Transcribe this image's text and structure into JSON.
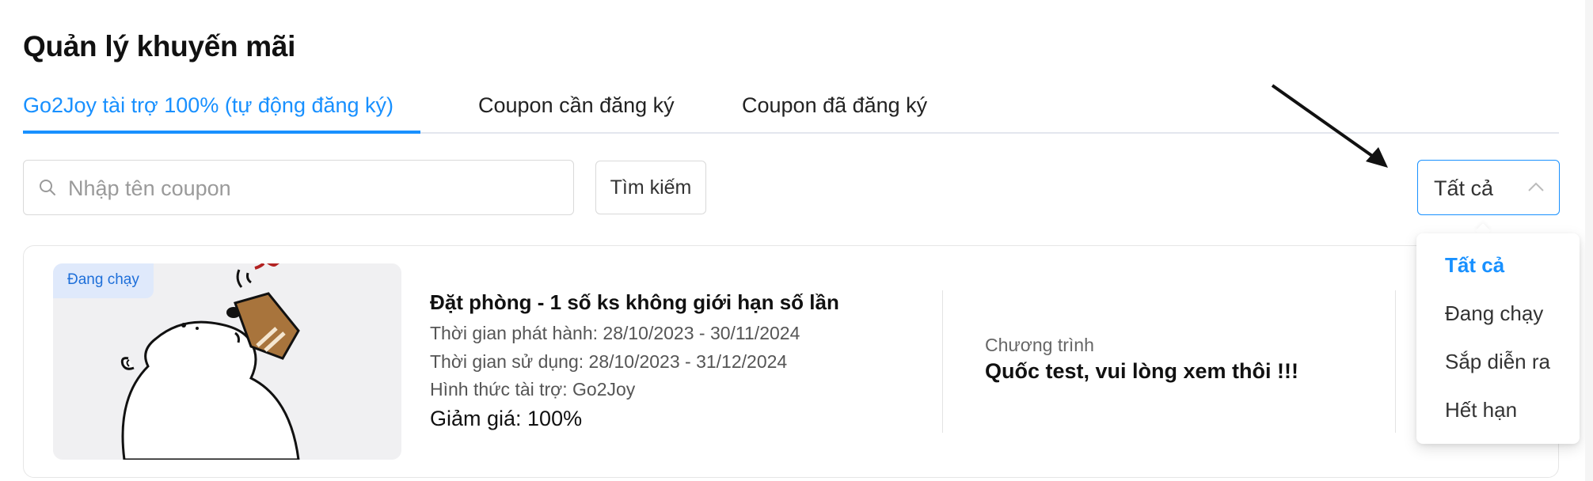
{
  "page": {
    "title": "Quản lý khuyến mãi"
  },
  "tabs": [
    {
      "label": "Go2Joy tài trợ 100% (tự động đăng ký)",
      "active": true
    },
    {
      "label": "Coupon cần đăng ký",
      "active": false
    },
    {
      "label": "Coupon đã đăng ký",
      "active": false
    }
  ],
  "search": {
    "placeholder": "Nhập tên coupon",
    "value": "",
    "button_label": "Tìm kiếm"
  },
  "status_filter": {
    "selected": "Tất cả",
    "options": [
      "Tất cả",
      "Đang chạy",
      "Sắp diễn ra",
      "Hết hạn"
    ]
  },
  "coupon": {
    "status": "Đang chạy",
    "title": "Đặt phòng - 1 số ks không giới hạn số lần",
    "release_period": "Thời gian phát hành: 28/10/2023 - 30/11/2024",
    "usage_period": "Thời gian sử dụng: 28/10/2023 - 31/12/2024",
    "sponsor": "Hình thức tài trợ: Go2Joy",
    "discount": "Giảm giá: 100%",
    "program_label": "Chương trình",
    "program_name": "Quốc test, vui lòng xem thôi !!!"
  },
  "colors": {
    "accent": "#1890ff",
    "badge_bg": "#dfe9fb",
    "thumb_bg": "#f0f0f2"
  },
  "icons": [
    "search-icon",
    "chevron-up-icon",
    "annotation-arrow",
    "bear-drinking-illustration"
  ]
}
